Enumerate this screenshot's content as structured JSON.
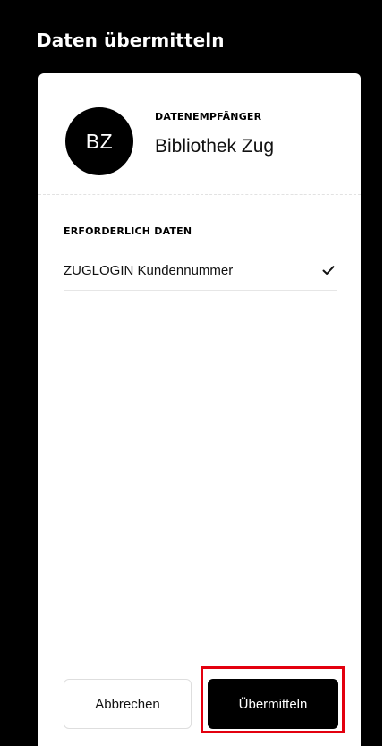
{
  "header": {
    "title": "Daten übermitteln"
  },
  "recipient": {
    "avatar_initials": "BZ",
    "label": "DATENEMPFÄNGER",
    "name": "Bibliothek Zug"
  },
  "required_data": {
    "label": "ERFORDERLICH DATEN",
    "items": [
      {
        "label": "ZUGLOGIN Kundennummer",
        "icon": "check-icon",
        "checked": true
      }
    ]
  },
  "actions": {
    "cancel_label": "Abbrechen",
    "submit_label": "Übermitteln"
  },
  "colors": {
    "background": "#000000",
    "card": "#ffffff",
    "primary_button": "#000000",
    "highlight": "#e3000f"
  }
}
